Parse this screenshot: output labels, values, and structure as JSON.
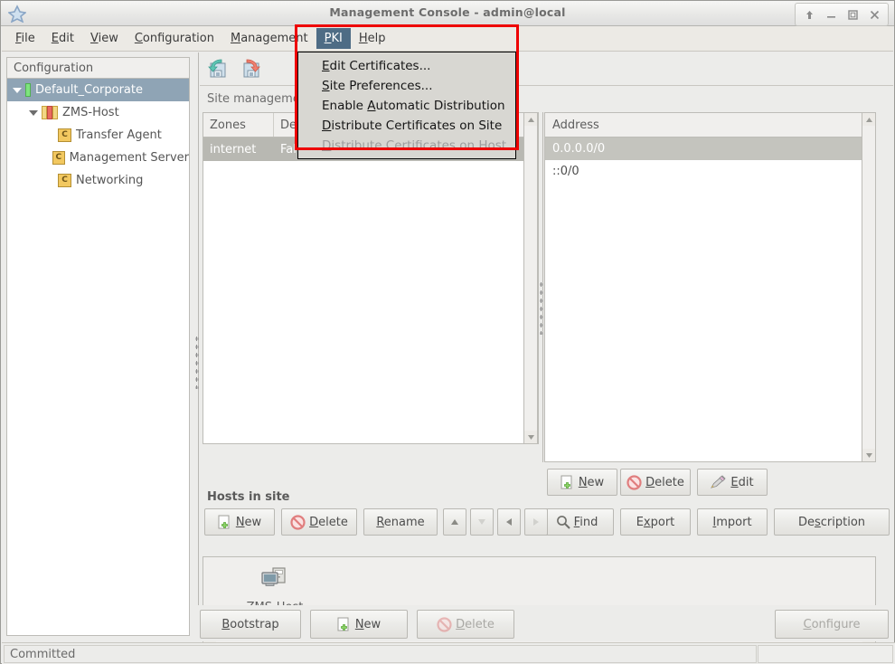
{
  "window": {
    "title": "Management Console - admin@local",
    "app_icon": "app-icon",
    "buttons": {
      "shade": "shade-window",
      "minimize": "minimize-window",
      "maximize": "maximize-window",
      "close": "close-window"
    }
  },
  "menubar": {
    "items": [
      {
        "label": "File",
        "mnemonic": "F",
        "selected": false
      },
      {
        "label": "Edit",
        "mnemonic": "E",
        "selected": false
      },
      {
        "label": "View",
        "mnemonic": "V",
        "selected": false
      },
      {
        "label": "Configuration",
        "mnemonic": "C",
        "selected": false
      },
      {
        "label": "Management",
        "mnemonic": "M",
        "selected": false
      },
      {
        "label": "PKI",
        "mnemonic": "P",
        "selected": true
      },
      {
        "label": "Help",
        "mnemonic": "H",
        "selected": false
      }
    ]
  },
  "pki_menu": {
    "items": [
      {
        "label": "Edit Certificates...",
        "mnemonic": "E",
        "disabled": false
      },
      {
        "label": "Site Preferences...",
        "mnemonic": "S",
        "disabled": false
      },
      {
        "label": "Enable Automatic Distribution",
        "mnemonic": "A",
        "disabled": false
      },
      {
        "label": "Distribute Certificates on Site",
        "mnemonic": "D",
        "disabled": false
      },
      {
        "label": "Distribute Certificates on Host",
        "mnemonic": "D",
        "disabled": true
      }
    ],
    "highlight_color": "#ee0000"
  },
  "sidebar": {
    "header": "Configuration",
    "nodes": [
      {
        "label": "Default_Corporate",
        "icon": "green-status-bar-icon",
        "depth": 0,
        "selected": true,
        "expanded": true
      },
      {
        "label": "ZMS-Host",
        "icon": "traffic-status-bars-icon",
        "depth": 1,
        "selected": false,
        "expanded": true
      },
      {
        "label": "Transfer Agent",
        "icon": "component-c-icon",
        "depth": 2,
        "selected": false,
        "expanded": null
      },
      {
        "label": "Management Server",
        "icon": "component-c-icon",
        "depth": 2,
        "selected": false,
        "expanded": null
      },
      {
        "label": "Networking",
        "icon": "component-c-icon",
        "depth": 2,
        "selected": false,
        "expanded": null
      }
    ]
  },
  "toolbar": {
    "buttons": [
      {
        "name": "revert-changes-button",
        "icon": "floppy-green-arrow-icon"
      },
      {
        "name": "commit-changes-button",
        "icon": "floppy-red-arrow-icon"
      }
    ]
  },
  "site_panel": {
    "title": "Site management",
    "zones": {
      "columns": [
        "Zones",
        "Des"
      ],
      "rows": [
        {
          "zone": "internet",
          "description": "Fallback zone",
          "selected": true
        }
      ]
    },
    "addresses": {
      "column": "Address",
      "rows": [
        {
          "value": "0.0.0.0/0",
          "selected": true
        },
        {
          "value": "::0/0",
          "selected": false
        }
      ],
      "buttons": [
        {
          "label": "New",
          "mnemonic": "N",
          "icon": "new-page-plus-icon",
          "disabled": false
        },
        {
          "label": "Delete",
          "mnemonic": "D",
          "icon": "delete-forbidden-icon",
          "disabled": false
        },
        {
          "label": "Edit",
          "mnemonic": "E",
          "icon": "pencil-edit-icon",
          "disabled": false
        }
      ]
    },
    "zone_buttons": [
      {
        "label": "New",
        "mnemonic": "N",
        "icon": "new-page-plus-icon",
        "disabled": false
      },
      {
        "label": "Delete",
        "mnemonic": "D",
        "icon": "delete-forbidden-icon",
        "disabled": false
      },
      {
        "label": "Rename",
        "mnemonic": "R",
        "icon": "",
        "disabled": false
      },
      {
        "label": "Find",
        "mnemonic": "F",
        "icon": "magnifier-icon",
        "disabled": false
      },
      {
        "label": "Export",
        "mnemonic": "x",
        "icon": "",
        "disabled": false
      },
      {
        "label": "Import",
        "mnemonic": "I",
        "icon": "",
        "disabled": false
      },
      {
        "label": "Description",
        "mnemonic": "s",
        "icon": "",
        "disabled": false
      }
    ],
    "move_buttons": [
      {
        "name": "move-up-button",
        "icon": "arrow-up-icon",
        "disabled": false
      },
      {
        "name": "move-down-button",
        "icon": "arrow-down-icon",
        "disabled": true
      },
      {
        "name": "move-left-button",
        "icon": "arrow-left-icon",
        "disabled": false
      },
      {
        "name": "move-right-button",
        "icon": "arrow-right-icon",
        "disabled": true
      }
    ]
  },
  "hosts_panel": {
    "title": "Hosts in site",
    "hosts": [
      {
        "label": "ZMS-Host",
        "icon": "computer-icon"
      }
    ],
    "buttons": [
      {
        "label": "Bootstrap",
        "mnemonic": "B",
        "icon": "",
        "disabled": false
      },
      {
        "label": "New",
        "mnemonic": "N",
        "icon": "new-page-plus-icon",
        "disabled": false
      },
      {
        "label": "Delete",
        "mnemonic": "D",
        "icon": "delete-forbidden-icon",
        "disabled": true
      },
      {
        "label": "Configure",
        "mnemonic": "C",
        "icon": "",
        "disabled": true
      }
    ]
  },
  "statusbar": {
    "text": "Committed"
  }
}
